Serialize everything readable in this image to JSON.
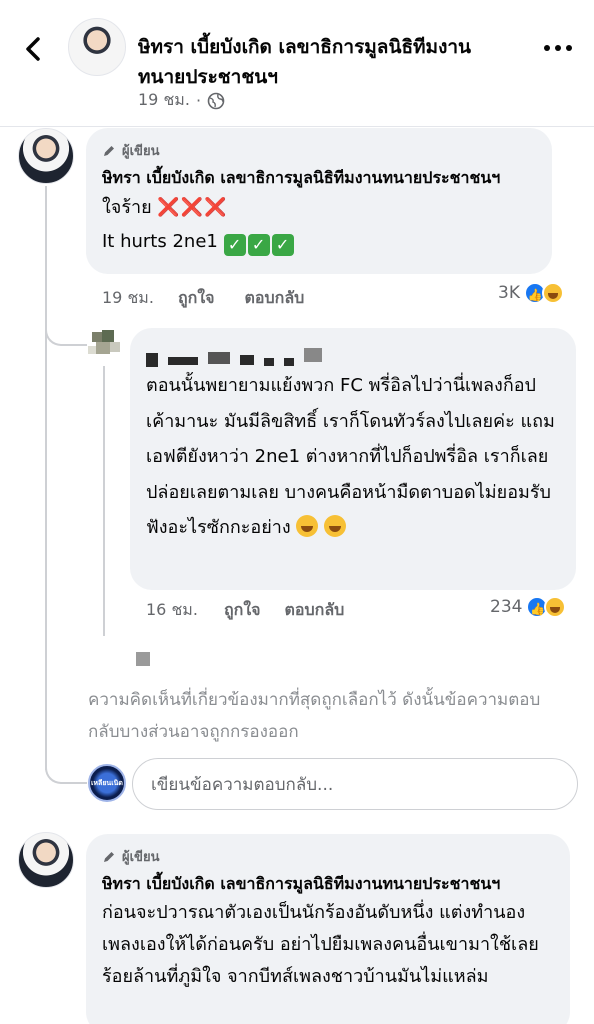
{
  "header": {
    "title": "ษิทรา เบี้ยบังเกิด เลขาธิการมูลนิธิทีมงานทนายประชาชนฯ",
    "time": "19 ชม.",
    "dot": "·",
    "privacy_icon": "globe-icon"
  },
  "comments": [
    {
      "badge": "ผู้เขียน",
      "author": "ษิทรา เบี้ยบังเกิด เลขาธิการมูลนิธิทีมงานทนายประชาชนฯ",
      "line1_text": "ใจร้าย",
      "line1_marks": "❌❌❌",
      "line2_text": "It hurts 2ne1",
      "line2_checks": [
        "✓",
        "✓",
        "✓"
      ],
      "time": "19 ชม.",
      "like_label": "ถูกใจ",
      "reply_label": "ตอบกลับ",
      "reaction_count": "3K"
    },
    {
      "text": "ตอนนั้นพยายามแย้งพวก FC พรี่อิลไปว่านี่เพลงก็อปเค้ามานะ มันมีลิขสิทธิ์ เราก็โดนทัวร์ลงไปเลยค่ะ แถมเอฟตียังหาว่า 2ne1 ต่างหากที่ไปก็อปพรี่อิล เราก็เลยปล่อยเลยตามเลย บางคนคือหน้ามืดตาบอดไม่ยอมรับฟังอะไรซักกะอย่าง",
      "time": "16 ชม.",
      "like_label": "ถูกใจ",
      "reply_label": "ตอบกลับ",
      "reaction_count": "234"
    },
    {
      "badge": "ผู้เขียน",
      "author": "ษิทรา เบี้ยบังเกิด เลขาธิการมูลนิธิทีมงานทนายประชาชนฯ",
      "text": "ก่อนจะปวารณาตัวเองเป็นนักร้องอันดับหนึ่ง แต่งทำนองเพลงเองให้ได้ก่อนครับ อย่าไปยืมเพลงคนอื่นเขามาใช้เลย ร้อยล้านที่ภูมิใจ จากบีทส์เพลงชาวบ้านมันไม่แหล่ม"
    }
  ],
  "notice": "ความคิดเห็นที่เกี่ยวข้องมากที่สุดถูกเลือกไว้ ดังนั้นข้อความตอบกลับบางส่วนอาจถูกกรองออก",
  "reply_box": {
    "placeholder": "เขียนข้อความตอบกลับ...",
    "avatar_text": "เหลียนเนิด"
  },
  "colors": {
    "bubble": "#f0f2f5",
    "secondary_text": "#65676b",
    "like_blue": "#1877f2",
    "check_green": "#3aa745",
    "x_red": "#e02020"
  }
}
